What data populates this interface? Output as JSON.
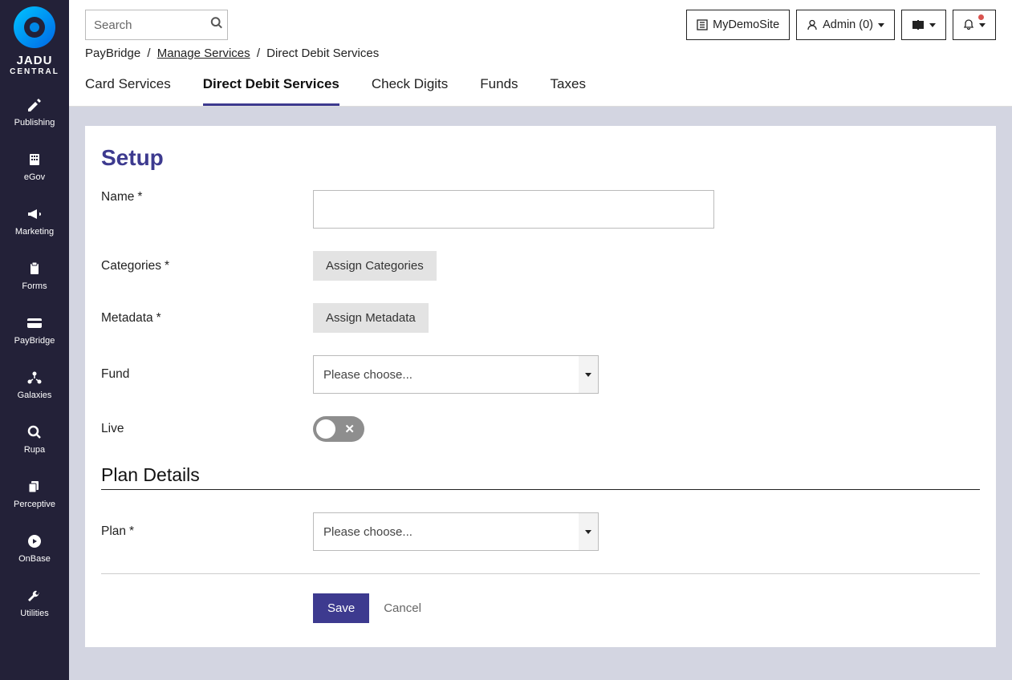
{
  "brand": {
    "name": "JADU",
    "sub": "CENTRAL"
  },
  "sidebar": {
    "items": [
      {
        "label": "Publishing",
        "icon": "pencil"
      },
      {
        "label": "eGov",
        "icon": "building"
      },
      {
        "label": "Marketing",
        "icon": "bullhorn"
      },
      {
        "label": "Forms",
        "icon": "clipboard"
      },
      {
        "label": "PayBridge",
        "icon": "card"
      },
      {
        "label": "Galaxies",
        "icon": "nodes"
      },
      {
        "label": "Rupa",
        "icon": "search"
      },
      {
        "label": "Perceptive",
        "icon": "copy"
      },
      {
        "label": "OnBase",
        "icon": "play-circle"
      },
      {
        "label": "Utilities",
        "icon": "wrench"
      }
    ]
  },
  "search": {
    "placeholder": "Search"
  },
  "topbar": {
    "site_label": "MyDemoSite",
    "admin_label": "Admin (0)"
  },
  "breadcrumb": {
    "a": "PayBridge",
    "b": "Manage Services",
    "c": "Direct Debit Services"
  },
  "tabs": [
    {
      "label": "Card Services",
      "active": false
    },
    {
      "label": "Direct Debit Services",
      "active": true
    },
    {
      "label": "Check Digits",
      "active": false
    },
    {
      "label": "Funds",
      "active": false
    },
    {
      "label": "Taxes",
      "active": false
    }
  ],
  "form": {
    "title": "Setup",
    "name_label": "Name",
    "categories_label": "Categories",
    "assign_categories_btn": "Assign Categories",
    "metadata_label": "Metadata",
    "assign_metadata_btn": "Assign Metadata",
    "fund_label": "Fund",
    "fund_selected": "Please choose...",
    "live_label": "Live",
    "section_plan": "Plan Details",
    "plan_label": "Plan",
    "plan_selected": "Please choose...",
    "save_label": "Save",
    "cancel_label": "Cancel"
  }
}
